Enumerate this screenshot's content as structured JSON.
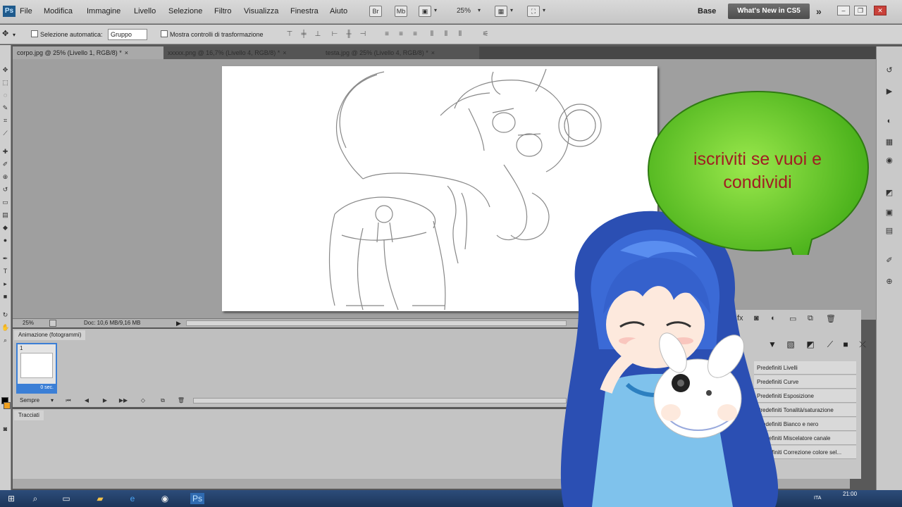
{
  "app": {
    "logo": "Ps",
    "menu": [
      "File",
      "Modifica",
      "Immagine",
      "Livello",
      "Selezione",
      "Filtro",
      "Visualizza",
      "Finestra",
      "Aiuto"
    ],
    "zoom": "25%",
    "workspace": "Base",
    "whats_new": "What's New in CS5",
    "overflow": "»"
  },
  "options": {
    "auto_select_label": "Selezione automatica:",
    "auto_select_value": "Gruppo",
    "show_transform_label": "Mostra controlli di trasformazione"
  },
  "tabs": [
    {
      "label": "corpo.jpg @ 25% (Livello 1, RGB/8) *",
      "active": true
    },
    {
      "label": "xxxxx.png @ 16,7% (Livello 4, RGB/8) *",
      "active": false
    },
    {
      "label": "testa.jpg @ 25% (Livello 4, RGB/8) *",
      "active": false
    }
  ],
  "status": {
    "zoom": "25%",
    "doc": "Doc: 10,6 MB/9,16 MB"
  },
  "animation": {
    "tab_label": "Animazione (fotogrammi)",
    "frame_number": "1",
    "frame_time": "0 sec.",
    "loop": "Sempre"
  },
  "paths": {
    "tab_label": "Tracciati"
  },
  "adjustments": {
    "presets": [
      "Predefiniti Livelli",
      "Predefiniti Curve",
      "Predefiniti Esposizione",
      "Predefiniti Tonalità/saturazione",
      "Predefiniti Bianco e nero",
      "Predefiniti Miscelatore canale",
      "Predefiniti Correzione colore sel..."
    ]
  },
  "overlay": {
    "bubble_text_line1": "iscriviti se vuoi e",
    "bubble_text_line2": "condividi",
    "bubble_color": "#5fc520"
  },
  "taskbar": {
    "time": "21:00",
    "lang": "ITA"
  }
}
